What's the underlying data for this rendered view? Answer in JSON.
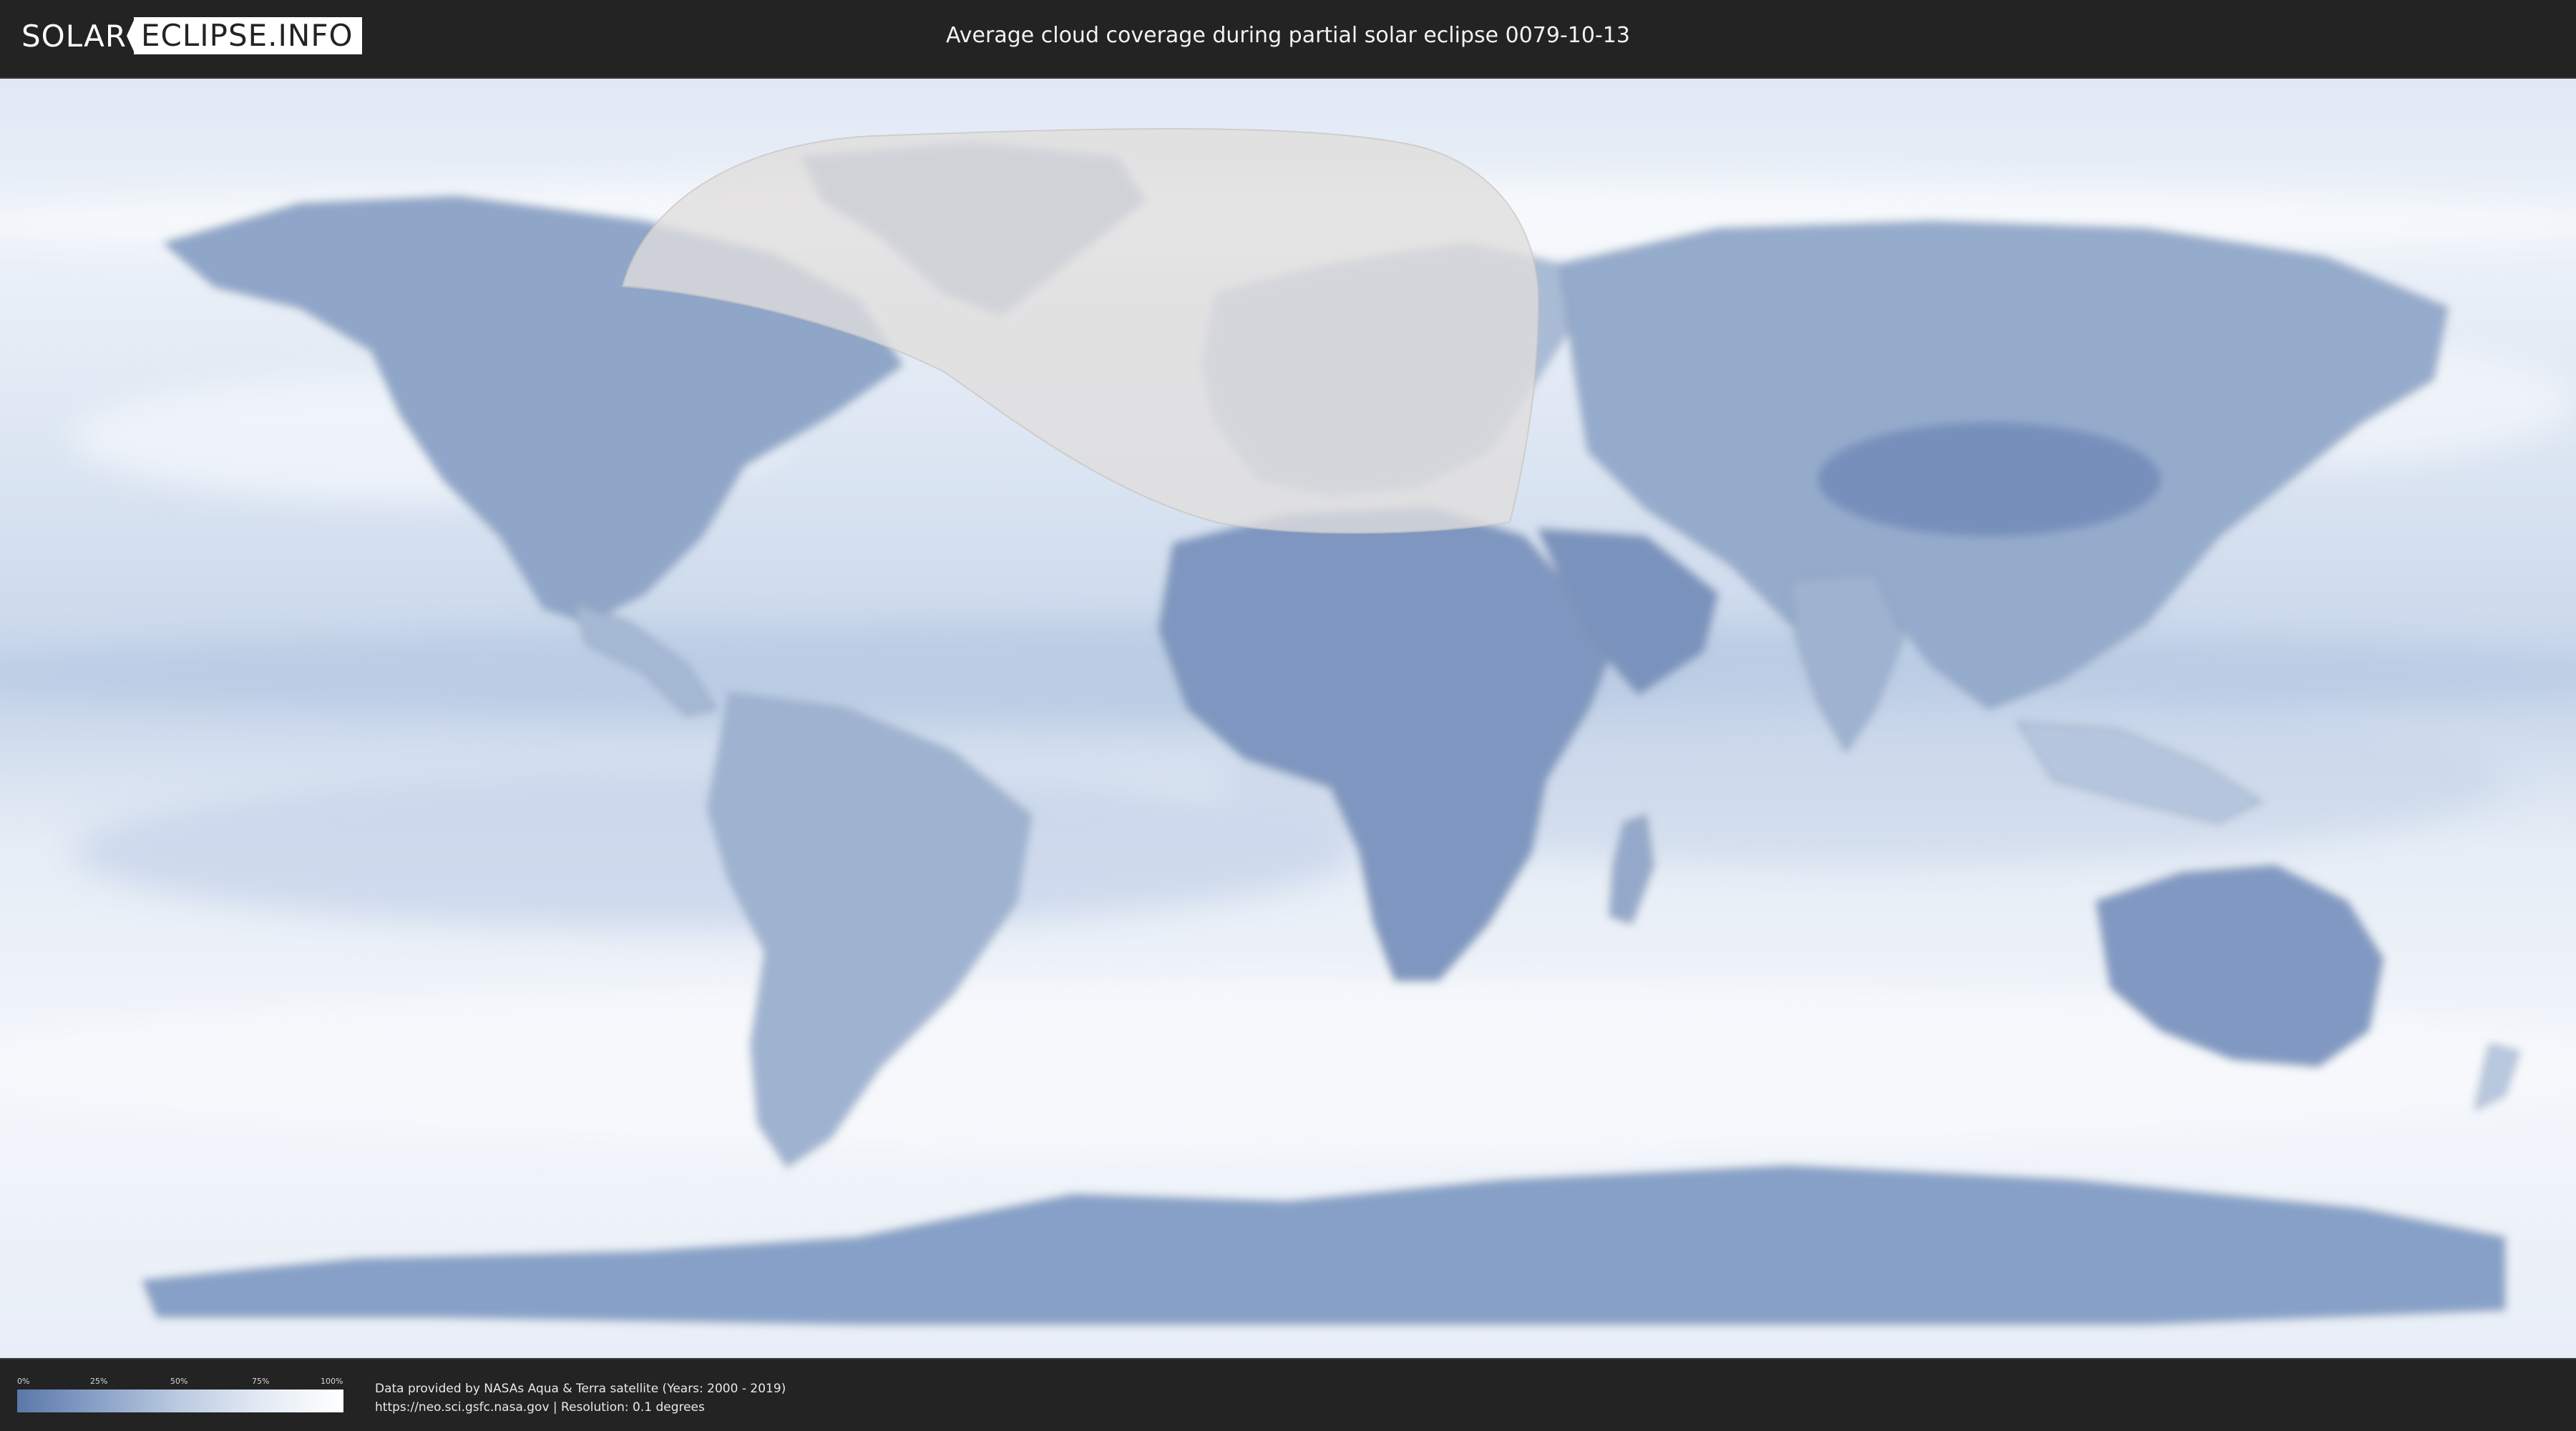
{
  "header": {
    "logo_left": "SOLAR",
    "logo_right": "ECLIPSE.INFO",
    "title": "Average cloud coverage during partial solar eclipse 0079-10-13"
  },
  "map": {
    "palette": {
      "clear_sky": "#5a78a8",
      "full_cloud": "#ffffff",
      "land_outline": "#7f8ea6",
      "eclipse_area": "#e0dedd"
    }
  },
  "legend": {
    "ticks": [
      "0%",
      "25%",
      "50%",
      "75%",
      "100%"
    ]
  },
  "attribution": {
    "line1": "Data provided by NASAs Aqua & Terra satellite (Years: 2000 - 2019)",
    "line2": "https://neo.sci.gsfc.nasa.gov | Resolution: 0.1 degrees"
  }
}
